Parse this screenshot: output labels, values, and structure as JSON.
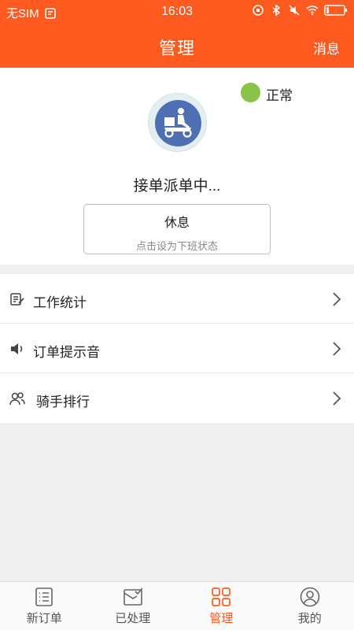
{
  "statusbar": {
    "carrier": "无SIM",
    "time": "16:03"
  },
  "header": {
    "title": "管理",
    "messages_label": "消息"
  },
  "profile": {
    "status_label": "正常",
    "status_color": "#8bc34a",
    "working_text": "接单派单中...",
    "rest_button": {
      "label": "休息",
      "hint": "点击设为下班状态"
    }
  },
  "menu": {
    "items": [
      {
        "label": "工作统计",
        "icon": "edit-stats-icon"
      },
      {
        "label": "订单提示音",
        "icon": "speaker-icon"
      },
      {
        "label": "骑手排行",
        "icon": "users-icon"
      }
    ]
  },
  "tabbar": {
    "tabs": [
      {
        "label": "新订单",
        "icon": "list-icon",
        "active": false
      },
      {
        "label": "已处理",
        "icon": "envelope-check-icon",
        "active": false
      },
      {
        "label": "管理",
        "icon": "grid-icon",
        "active": true
      },
      {
        "label": "我的",
        "icon": "person-icon",
        "active": false
      }
    ]
  },
  "colors": {
    "brand": "#ff5a1f",
    "background": "#f0f0f0"
  }
}
